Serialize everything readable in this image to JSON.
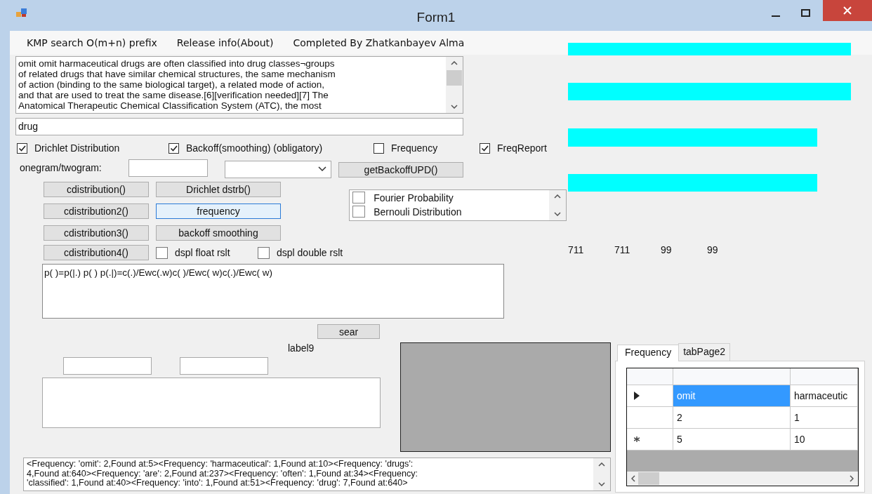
{
  "window": {
    "title": "Form1"
  },
  "menu": [
    {
      "label": "KMP search O(m+n) prefix"
    },
    {
      "label": "Release info(About)"
    },
    {
      "label": "Completed By Zhatkanbayev Alma"
    }
  ],
  "source_text": {
    "value": "omit omit harmaceutical drugs are often classified into drug classes¬groups\nof related drugs that have similar chemical structures, the same mechanism\nof action (binding to the same biological target), a related mode of action,\nand that are used to treat the same disease.[6][verification needed][7] The\nAnatomical Therapeutic Chemical Classification System (ATC), the most"
  },
  "search_field": {
    "value": "drug"
  },
  "options": [
    {
      "label": "Drichlet Distribution",
      "checked": true
    },
    {
      "label": "Backoff(smoothing) (obligatory)",
      "checked": true
    },
    {
      "label": "Frequency",
      "checked": false
    },
    {
      "label": "FreqReport",
      "checked": true
    }
  ],
  "ngram": {
    "label": "onegram/twogram:",
    "button": "getBackoffUPD()"
  },
  "buttons_col1": [
    {
      "label": "cdistribution()",
      "focused": false
    },
    {
      "label": "cdistribution2()",
      "focused": false
    },
    {
      "label": "cdistribution3()",
      "focused": false
    },
    {
      "label": "cdistribution4()",
      "focused": false
    }
  ],
  "buttons_col2": [
    {
      "label": "Drichlet dstrb()",
      "focused": false
    },
    {
      "label": "frequency",
      "focused": true
    },
    {
      "label": "backoff smoothing",
      "focused": false
    }
  ],
  "result_options": [
    {
      "label": "dspl float rslt",
      "checked": false
    },
    {
      "label": "dspl double rslt",
      "checked": false
    }
  ],
  "checklist": [
    {
      "label": "Fourier Probability",
      "checked": false
    },
    {
      "label": "Bernouli Distribution",
      "checked": false
    }
  ],
  "formula_box": {
    "value": "p( )=p(|.) p( ) p(.|)=c(.)/Ewc(.w)c( )/Ewc( w)c(.)/Ewc( w)"
  },
  "search_button": {
    "label": "sear"
  },
  "label9": {
    "text": "label9"
  },
  "report_box": {
    "value": "<Frequency: 'omit': 2,Found at:5><Frequency: 'harmaceutical': 1,Found at:10><Frequency: 'drugs':\n4,Found at:640><Frequency: 'are': 2,Found at:237><Frequency: 'often': 1,Found at:34><Frequency:\n'classified': 1,Found at:40><Frequency: 'into': 1,Found at:51><Frequency: 'drug': 7,Found at:640>"
  },
  "bars": [
    {
      "level": 1
    },
    {
      "level": 1
    },
    {
      "level": 0.88
    },
    {
      "level": 0.88
    }
  ],
  "counters": [
    "711",
    "711",
    "99",
    "99"
  ],
  "tabs": [
    {
      "label": "Frequency",
      "selected": true
    },
    {
      "label": "tabPage2",
      "selected": false
    }
  ],
  "grid": {
    "rows": [
      {
        "current": true,
        "new": false,
        "cells": [
          {
            "text": "omit",
            "selected": true
          },
          {
            "text": "harmaceutic",
            "selected": false
          }
        ]
      },
      {
        "current": false,
        "new": false,
        "cells": [
          {
            "text": "2",
            "selected": false
          },
          {
            "text": "1",
            "selected": false
          }
        ]
      },
      {
        "current": false,
        "new": true,
        "cells": [
          {
            "text": "5",
            "selected": false
          },
          {
            "text": "10",
            "selected": false
          }
        ]
      }
    ]
  }
}
